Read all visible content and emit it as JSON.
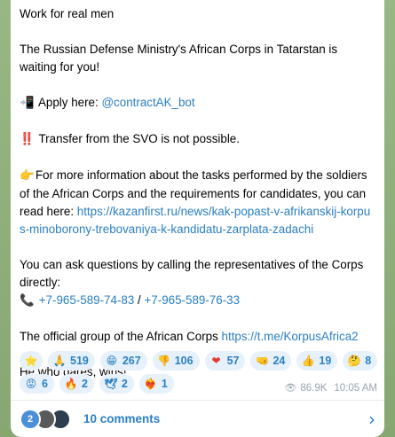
{
  "post": {
    "line1": "Work for real men",
    "line2": "The Russian Defense Ministry's African Corps in Tatarstan is waiting for you!",
    "apply_icon": "📲",
    "apply_label": "Apply here: ",
    "apply_link": "@contractAK_bot",
    "transfer_icon": "‼️",
    "transfer_text": "Transfer from the SVO is not possible.",
    "info_icon": "👉",
    "info_text": "For more information about the tasks performed by the soldiers of the African Corps and the requirements for candidates, you can read here: ",
    "info_link": "https://kazanfirst.ru/news/kak-popast-v-afrikanskij-korpus-minoborony-trebovaniya-k-kandidatu-zarplata-zadachi",
    "questions_text": "You can ask questions by calling the representatives of the Corps directly:",
    "phone_icon": "📞",
    "phone1": "+7-965-589-74-83",
    "phone_sep": " / ",
    "phone2": "+7-965-589-76-33",
    "group_text": "The official group of the African Corps ",
    "group_link": "https://t.me/KorpusAfrica2",
    "closing": "He who dares, wins!"
  },
  "reactions": [
    {
      "icon": "⭐",
      "count": ""
    },
    {
      "icon": "🙏",
      "count": "519"
    },
    {
      "icon": "😁",
      "count": "267"
    },
    {
      "icon": "👎",
      "count": "106"
    },
    {
      "icon": "❤",
      "count": "57"
    },
    {
      "icon": "🤜",
      "count": "24"
    },
    {
      "icon": "👍",
      "count": "19"
    },
    {
      "icon": "🤔",
      "count": "8"
    },
    {
      "icon": "😡",
      "count": "6"
    },
    {
      "icon": "🔥",
      "count": "2"
    },
    {
      "icon": "🕊",
      "count": "2"
    },
    {
      "icon": "❤️‍🔥",
      "count": "1"
    }
  ],
  "meta": {
    "views": "86.9K",
    "time": "10:05 AM"
  },
  "comments": {
    "avatar_count": "2",
    "label": "10 comments"
  },
  "colors": {
    "link": "#2a7fc3",
    "reaction_bg": "#e6f1fb",
    "background": "#8fb07c"
  }
}
